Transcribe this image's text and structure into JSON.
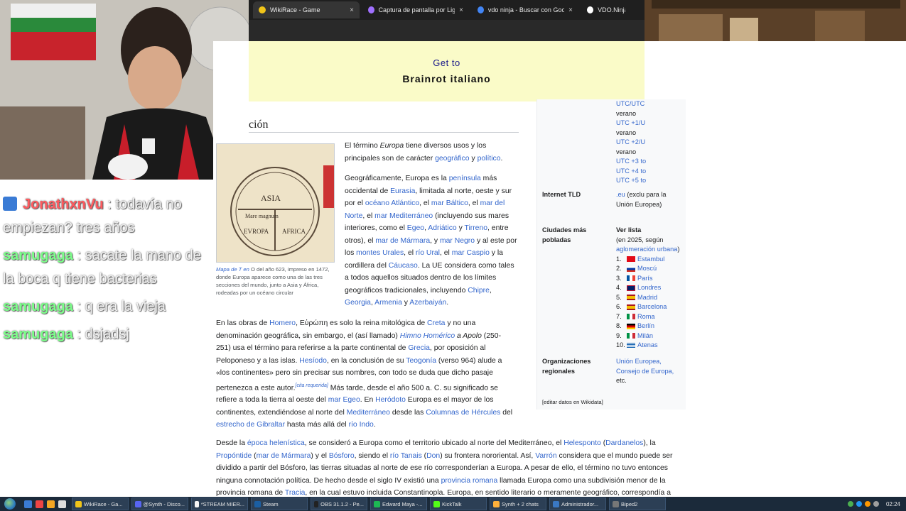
{
  "browser": {
    "tabs": [
      {
        "label": "WikiRace - Game",
        "close": "×",
        "active": true,
        "color": "#f0c419"
      },
      {
        "label": "Captura de pantalla por Lightsh",
        "close": "×",
        "active": false,
        "color": "#a070ff"
      },
      {
        "label": "vdo ninja - Buscar con Google",
        "close": "×",
        "active": false,
        "color": "#4285f4"
      },
      {
        "label": "VDO.Ninja",
        "close": "",
        "active": false,
        "color": "#ffffff"
      }
    ]
  },
  "banner": {
    "line1": "Get to",
    "line2": "Brainrot italiano"
  },
  "section": {
    "title": "ción"
  },
  "image": {
    "caption_link": "Mapa de T en",
    "caption_text": " O del año 623, impreso en 1472, donde Europa aparece como una de las tres secciones del mundo, junto a Asia y África, rodeadas por un océano circular",
    "map_words": [
      "ASIA",
      "Mare magnum",
      "EVROPA",
      "AFRICA"
    ]
  },
  "article": {
    "p1": [
      {
        "t": "El término "
      },
      {
        "t": "Europa",
        "i": true
      },
      {
        "t": " tiene diversos usos y los principales son de carácter "
      },
      {
        "t": "geográfico",
        "l": true
      },
      {
        "t": " y "
      },
      {
        "t": "político",
        "l": true
      },
      {
        "t": "."
      }
    ],
    "p2": [
      {
        "t": "Geográficamente, Europa es la "
      },
      {
        "t": "península",
        "l": true
      },
      {
        "t": " más occidental de "
      },
      {
        "t": "Eurasia",
        "l": true
      },
      {
        "t": ", limitada al norte, oeste y sur por el "
      },
      {
        "t": "océano Atlántico",
        "l": true
      },
      {
        "t": ", el "
      },
      {
        "t": "mar Báltico",
        "l": true
      },
      {
        "t": ", el "
      },
      {
        "t": "mar del Norte",
        "l": true
      },
      {
        "t": ", el "
      },
      {
        "t": "mar Mediterráneo",
        "l": true
      },
      {
        "t": " (incluyendo sus mares interiores, como el "
      },
      {
        "t": "Egeo",
        "l": true
      },
      {
        "t": ", "
      },
      {
        "t": "Adriático",
        "l": true
      },
      {
        "t": " y "
      },
      {
        "t": "Tirreno",
        "l": true
      },
      {
        "t": ", entre otros), el "
      },
      {
        "t": "mar de Mármara",
        "l": true
      },
      {
        "t": ", y "
      },
      {
        "t": "mar Negro",
        "l": true
      },
      {
        "t": " y al este por los "
      },
      {
        "t": "montes Urales",
        "l": true
      },
      {
        "t": ", el "
      },
      {
        "t": "río Ural",
        "l": true
      },
      {
        "t": ", el "
      },
      {
        "t": "mar Caspio",
        "l": true
      },
      {
        "t": " y la cordillera del "
      },
      {
        "t": "Cáucaso",
        "l": true
      },
      {
        "t": ". La UE considera como tales a todos aquellos situados dentro de los límites geográficos tradicionales, incluyendo "
      },
      {
        "t": "Chipre",
        "l": true
      },
      {
        "t": ", "
      },
      {
        "t": "Georgia",
        "l": true
      },
      {
        "t": ", "
      },
      {
        "t": "Armenia",
        "l": true
      },
      {
        "t": " y "
      },
      {
        "t": "Azerbaiyán",
        "l": true
      },
      {
        "t": "."
      }
    ],
    "p3": [
      {
        "t": "En las obras de "
      },
      {
        "t": "Homero",
        "l": true
      },
      {
        "t": ", Εὐρώπη es solo la reina mitológica de "
      },
      {
        "t": "Creta",
        "l": true
      },
      {
        "t": " y no una denominación geográfica, sin embargo, el (así llamado) "
      },
      {
        "t": "Himno Homérico",
        "l": true,
        "i": true
      },
      {
        "t": " a Apolo",
        "i": true
      },
      {
        "t": " (250-251) usa el término para referirse a la parte continental de "
      },
      {
        "t": "Grecia",
        "l": true
      },
      {
        "t": ", por oposición al Peloponeso y a las islas. "
      },
      {
        "t": "Hesíodo",
        "l": true
      },
      {
        "t": ", en la conclusión de su "
      },
      {
        "t": "Teogonía",
        "l": true
      },
      {
        "t": " (verso 964) alude a «los continentes» pero sin precisar sus nombres, con todo se duda que dicho pasaje pertenezca a este autor."
      },
      {
        "t": "[cita requerida]",
        "l": true,
        "s": true
      },
      {
        "t": " Más tarde, desde el año 500 a. C. su significado se refiere a toda la tierra al oeste del "
      },
      {
        "t": "mar Egeo",
        "l": true
      },
      {
        "t": ". En "
      },
      {
        "t": "Heródoto",
        "l": true
      },
      {
        "t": " Europa es el mayor de los continentes, extendiéndose al norte del "
      },
      {
        "t": "Mediterráneo",
        "l": true
      },
      {
        "t": " desde las "
      },
      {
        "t": "Columnas de Hércules",
        "l": true
      },
      {
        "t": " del "
      },
      {
        "t": "estrecho de Gibraltar",
        "l": true
      },
      {
        "t": " hasta más allá del "
      },
      {
        "t": "río Indo",
        "l": true
      },
      {
        "t": "."
      }
    ],
    "p4": [
      {
        "t": "Desde la "
      },
      {
        "t": "época helenística",
        "l": true
      },
      {
        "t": ", se consideró a Europa como el territorio ubicado al norte del Mediterráneo, el "
      },
      {
        "t": "Helesponto",
        "l": true
      },
      {
        "t": " ("
      },
      {
        "t": "Dardanelos",
        "l": true
      },
      {
        "t": "), la "
      },
      {
        "t": "Propóntide",
        "l": true
      },
      {
        "t": " ("
      },
      {
        "t": "mar de Mármara",
        "l": true
      },
      {
        "t": ") y el "
      },
      {
        "t": "Bósforo",
        "l": true
      },
      {
        "t": ", siendo el "
      },
      {
        "t": "río Tanais",
        "l": true
      },
      {
        "t": " ("
      },
      {
        "t": "Don",
        "l": true
      },
      {
        "t": ") su frontera nororiental. Así, "
      },
      {
        "t": "Varrón",
        "l": true
      },
      {
        "t": " considera que el mundo puede ser dividido a partir del Bósforo, las tierras situadas al norte de ese río corresponderían a Europa. A pesar de ello, el término no tuvo entonces ninguna connotación política. De hecho desde el siglo IV existió una "
      },
      {
        "t": "provincia romana",
        "l": true
      },
      {
        "t": " llamada Europa como una subdivisión menor de la provincia romana de "
      },
      {
        "t": "Tracia",
        "l": true
      },
      {
        "t": ", en la cual estuvo incluida Constantinopla. Europa, en sentido literario o meramente geográfico, correspondía a"
      }
    ]
  },
  "infobox": {
    "tz": [
      "UTC/UTC",
      "verano",
      "UTC +1/U",
      "verano",
      "UTC +2/U",
      "verano",
      "UTC +3 to",
      "UTC +4 to",
      "UTC +5 to"
    ],
    "tld_label": "Internet TLD",
    "tld_value_link": ".eu",
    "tld_value_text": " (exclu para la Unión Europea)",
    "cities_label": "Ciudades más pobladas",
    "cities_link": "Ver lista",
    "cities_note_a": "(en 2025, según ",
    "cities_note_link": "aglomeración urbana",
    "cities_note_b": ")",
    "cities": [
      {
        "n": "1.",
        "name": "Estambul",
        "flag": "tr"
      },
      {
        "n": "2.",
        "name": "Moscú",
        "flag": "ru"
      },
      {
        "n": "3.",
        "name": "París",
        "flag": "fr"
      },
      {
        "n": "4.",
        "name": "Londres",
        "flag": "uk"
      },
      {
        "n": "5.",
        "name": "Madrid",
        "flag": "es"
      },
      {
        "n": "6.",
        "name": "Barcelona",
        "flag": "es"
      },
      {
        "n": "7.",
        "name": "Roma",
        "flag": "it"
      },
      {
        "n": "8.",
        "name": "Berlín",
        "flag": "de"
      },
      {
        "n": "9.",
        "name": "Milán",
        "flag": "it"
      },
      {
        "n": "10.",
        "name": "Atenas",
        "flag": "gr"
      }
    ],
    "orgs_label": "Organizaciones regionales",
    "orgs": [
      "Unión Europea,",
      "Consejo de Europa,"
    ],
    "orgs_tail": "etc.",
    "edit": "[editar datos en Wikidata]"
  },
  "chat": [
    {
      "user": "JonathxnVu",
      "color": "#ff5a5f",
      "badge": true,
      "text": ": todavía no empiezan? tres años"
    },
    {
      "user": "samugaga",
      "color": "#7cff8a",
      "badge": false,
      "text": ": sacate la mano de la boca q tiene bacterias"
    },
    {
      "user": "samugaga",
      "color": "#7cff8a",
      "badge": false,
      "text": ": q era la vieja"
    },
    {
      "user": "samugaga",
      "color": "#7cff8a",
      "badge": false,
      "text": ": dsjadsj"
    }
  ],
  "taskbar": {
    "tasks": [
      {
        "label": "WikiRace - Ga...",
        "color": "#f0c419"
      },
      {
        "label": "@Synth - Disco...",
        "color": "#5865f2"
      },
      {
        "label": "*STREAM MIER...",
        "color": "#f5f5f5"
      },
      {
        "label": "Steam",
        "color": "#1b5fa3"
      },
      {
        "label": "OBS 31.1.2 - Pe...",
        "color": "#222222"
      },
      {
        "label": "Edward Maya -...",
        "color": "#1db954"
      },
      {
        "label": "KickTalk",
        "color": "#53fc18"
      },
      {
        "label": "Synth + 2 chats",
        "color": "#ffb13b"
      },
      {
        "label": "Administrador...",
        "color": "#3a78c3"
      },
      {
        "label": "Biped2",
        "color": "#777777"
      }
    ],
    "time": "02:24"
  },
  "colors": {
    "link": "#3366cc",
    "banner_bg": "#fafbc8",
    "taskbar": "#1b2a3a"
  }
}
